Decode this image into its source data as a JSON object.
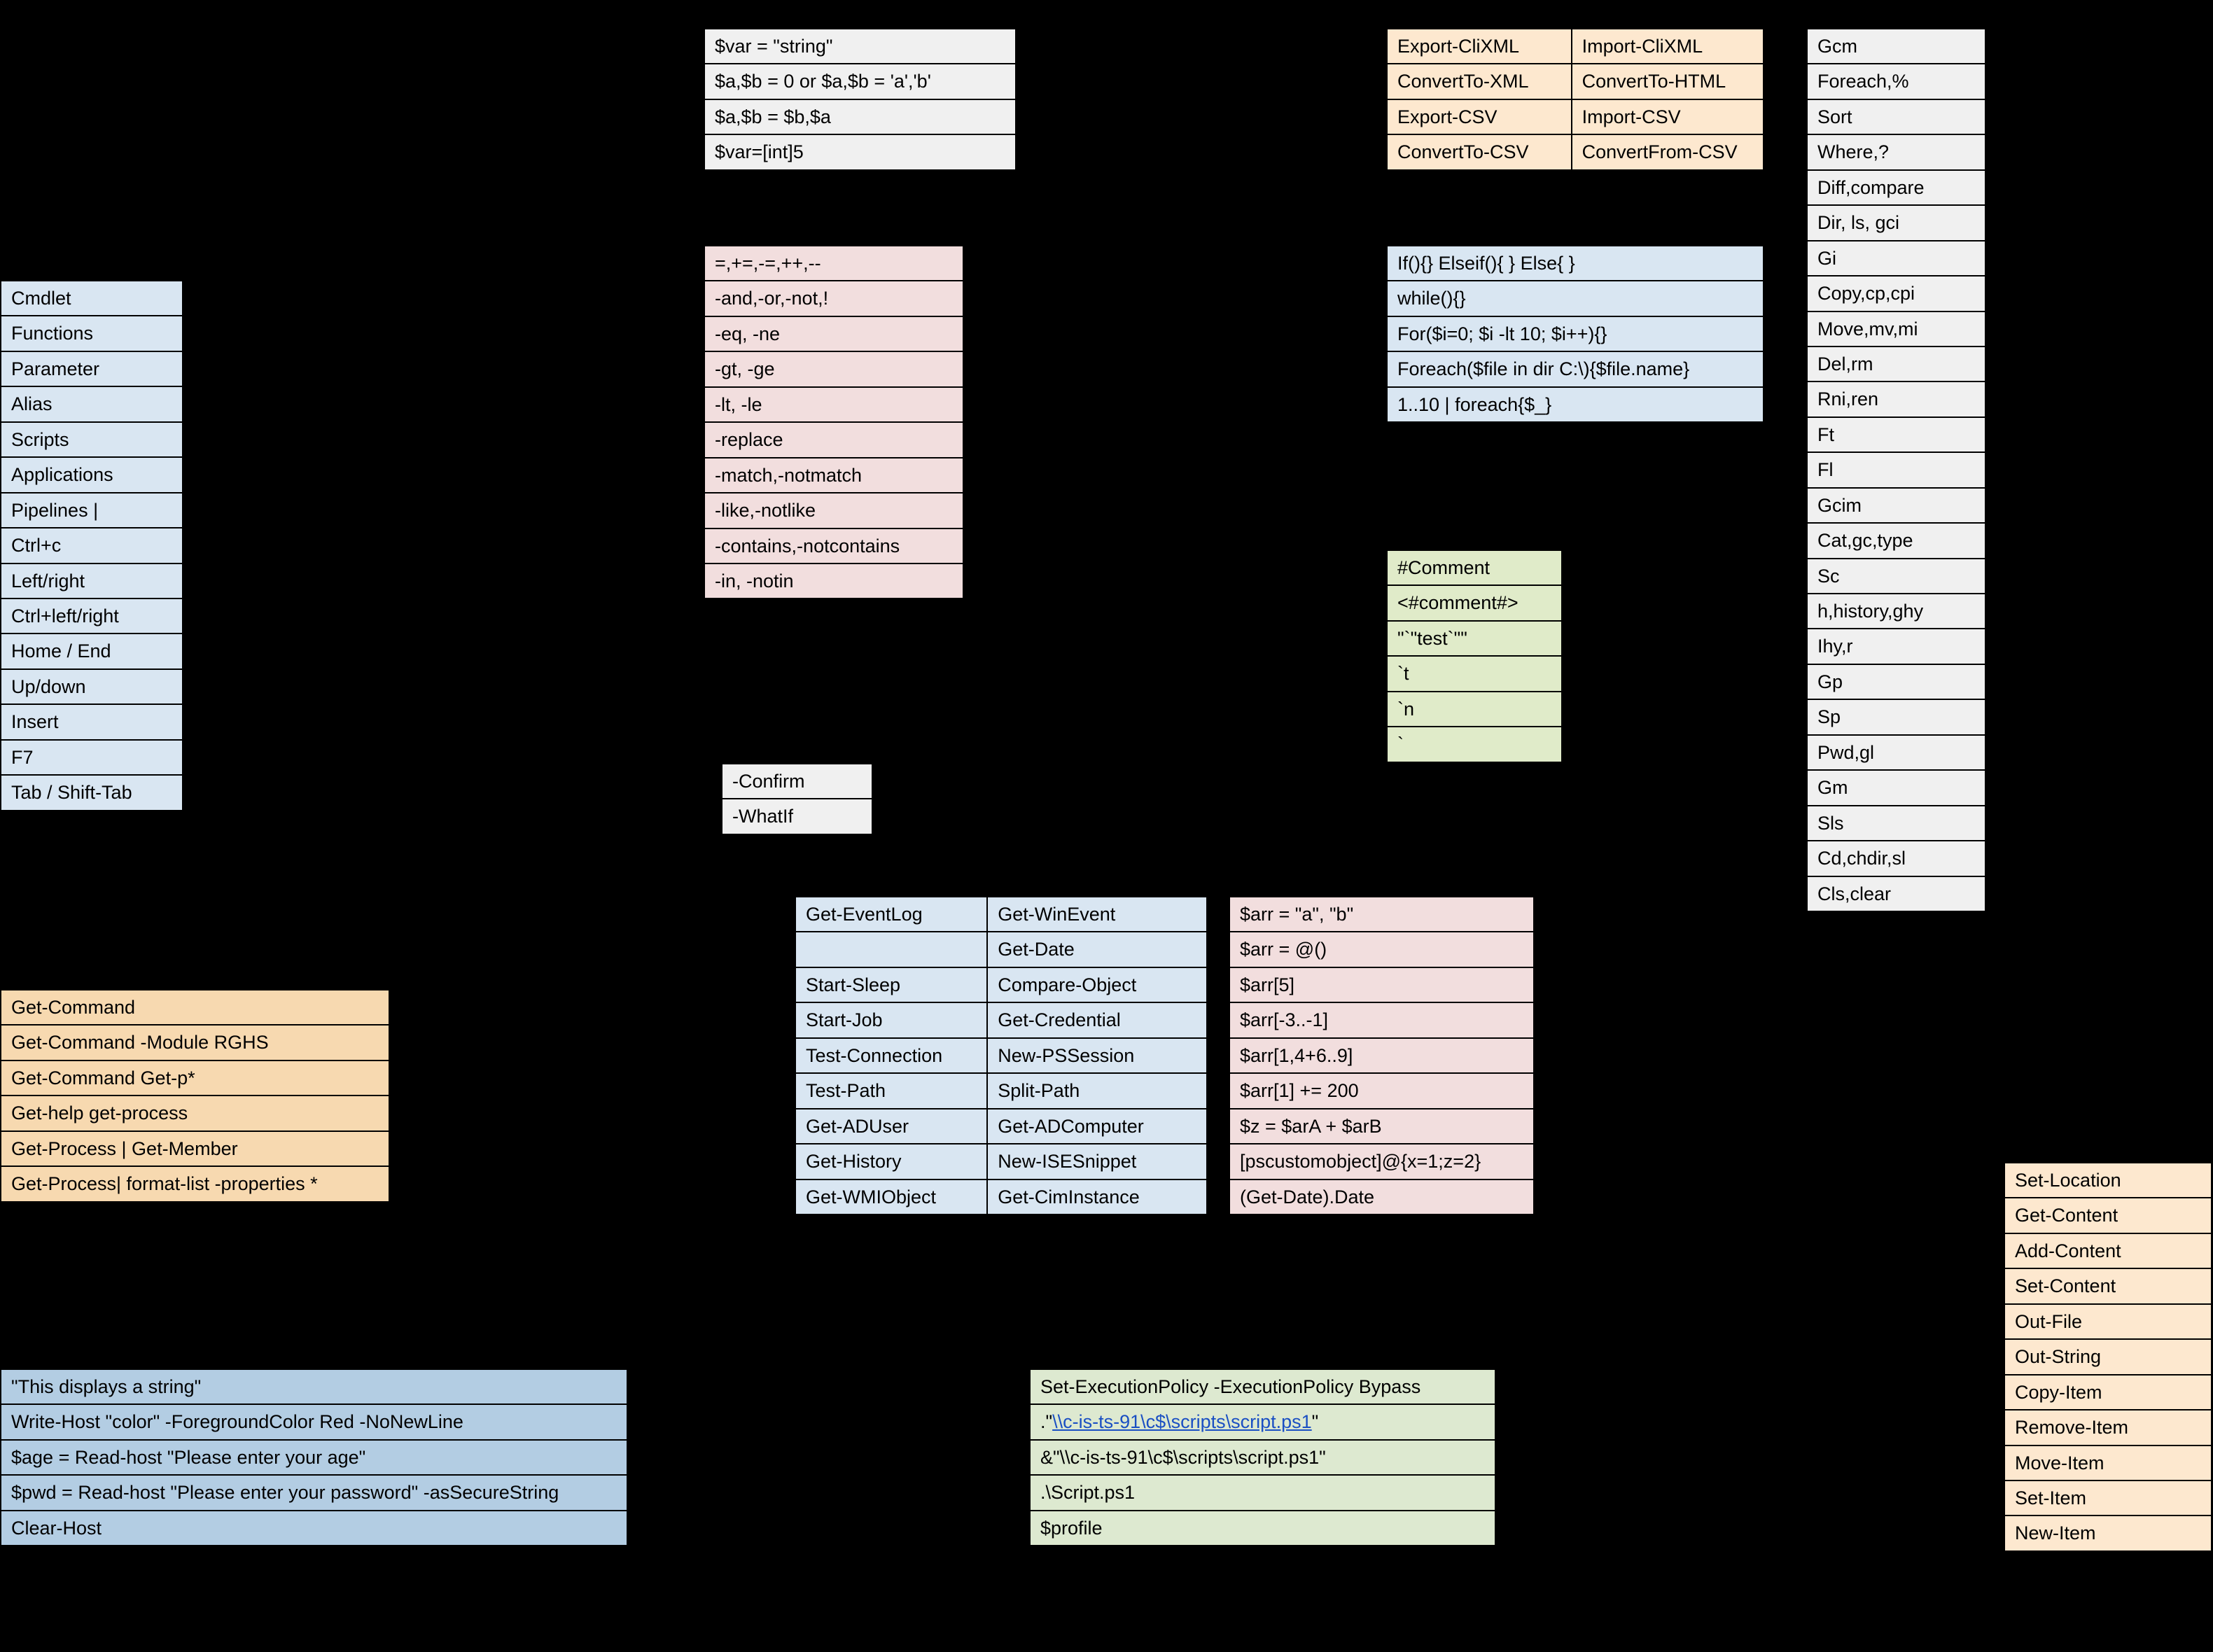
{
  "concepts": {
    "rows": [
      [
        "Cmdlet",
        ""
      ],
      [
        "Functions",
        ""
      ],
      [
        "Parameter",
        ""
      ],
      [
        "Alias",
        ""
      ],
      [
        "Scripts",
        ""
      ],
      [
        "Applications",
        ""
      ],
      [
        "Pipelines |",
        ""
      ],
      [
        "Ctrl+c",
        ""
      ],
      [
        "Left/right",
        ""
      ],
      [
        "Ctrl+left/right",
        ""
      ],
      [
        "Home / End",
        ""
      ],
      [
        "Up/down",
        ""
      ],
      [
        "Insert",
        ""
      ],
      [
        "F7",
        ""
      ],
      [
        "Tab / Shift-Tab",
        ""
      ]
    ]
  },
  "help": {
    "rows": [
      [
        "Get-Command",
        ""
      ],
      [
        "Get-Command -Module RGHS",
        ""
      ],
      [
        "Get-Command Get-p*",
        ""
      ],
      [
        "Get-help get-process",
        ""
      ],
      [
        "Get-Process | Get-Member",
        ""
      ],
      [
        "Get-Process| format-list -properties *",
        ""
      ]
    ]
  },
  "variables": {
    "rows": [
      [
        "$var = \"string\"",
        ""
      ],
      [
        "$a,$b = 0 or $a,$b = 'a','b'",
        ""
      ],
      [
        "$a,$b = $b,$a",
        ""
      ],
      [
        "$var=[int]5",
        ""
      ]
    ]
  },
  "operators": {
    "rows": [
      [
        "=,+=,-=,++,--",
        ""
      ],
      [
        "-and,-or,-not,!",
        ""
      ],
      [
        "-eq, -ne",
        ""
      ],
      [
        "-gt, -ge",
        ""
      ],
      [
        "-lt, -le",
        ""
      ],
      [
        "-replace",
        ""
      ],
      [
        "-match,-notmatch",
        ""
      ],
      [
        "-like,-notlike",
        ""
      ],
      [
        "-contains,-notcontains",
        ""
      ],
      [
        "-in, -notin",
        ""
      ]
    ]
  },
  "risk": {
    "rows": [
      [
        "-Confirm",
        ""
      ],
      [
        "-WhatIf",
        ""
      ]
    ]
  },
  "importexport": {
    "rows": [
      [
        "Export-CliXML",
        "Import-CliXML"
      ],
      [
        "ConvertTo-XML",
        "ConvertTo-HTML"
      ],
      [
        "Export-CSV",
        "Import-CSV"
      ],
      [
        "ConvertTo-CSV",
        "ConvertFrom-CSV"
      ]
    ]
  },
  "flow": {
    "rows": [
      [
        "If(){} Elseif(){ } Else{ }"
      ],
      [
        "while(){}"
      ],
      [
        "For($i=0; $i -lt 10; $i++){}"
      ],
      [
        "Foreach($file in dir C:\\){$file.name}"
      ],
      [
        "1..10 | foreach{$_}"
      ]
    ]
  },
  "comments": {
    "rows": [
      [
        "#Comment",
        ""
      ],
      [
        "<#comment#>",
        ""
      ],
      [
        "\"`\"test`\"\"",
        ""
      ],
      [
        "`t",
        ""
      ],
      [
        "`n",
        ""
      ],
      [
        "`",
        ""
      ]
    ]
  },
  "cmdlets2col": {
    "rows": [
      [
        "Get-EventLog",
        "Get-WinEvent"
      ],
      [
        "",
        "Get-Date"
      ],
      [
        "Start-Sleep",
        "Compare-Object"
      ],
      [
        "Start-Job",
        "Get-Credential"
      ],
      [
        "Test-Connection",
        "New-PSSession"
      ],
      [
        "Test-Path",
        "Split-Path"
      ],
      [
        "Get-ADUser",
        "Get-ADComputer"
      ],
      [
        "Get-History",
        "New-ISESnippet"
      ],
      [
        "Get-WMIObject",
        "Get-CimInstance"
      ]
    ]
  },
  "arrays": {
    "rows": [
      [
        "$arr = \"a\", \"b\"",
        ""
      ],
      [
        "$arr = @()",
        ""
      ],
      [
        "$arr[5]",
        ""
      ],
      [
        "$arr[-3..-1]",
        ""
      ],
      [
        "$arr[1,4+6..9]",
        ""
      ],
      [
        "$arr[1] += 200",
        ""
      ],
      [
        "$z = $arA + $arB",
        ""
      ],
      [
        "[pscustomobject]@{x=1;z=2}",
        ""
      ],
      [
        "(Get-Date).Date",
        ""
      ]
    ]
  },
  "writing": {
    "rows": [
      [
        "\"This displays a string\"",
        ""
      ],
      [
        "Write-Host \"color\" -ForegroundColor Red -NoNewLine",
        ""
      ],
      [
        "$age = Read-host \"Please enter your age\"",
        ""
      ],
      [
        "$pwd = Read-host \"Please enter your password\" -asSecureString",
        ""
      ],
      [
        "Clear-Host",
        ""
      ]
    ]
  },
  "scripts": {
    "rows": [
      [
        "Set-ExecutionPolicy -ExecutionPolicy Bypass",
        ""
      ],
      [
        ".\"\\\\c-is-ts-91\\c$\\scripts\\script.ps1\"",
        ""
      ],
      [
        "&\"\\\\c-is-ts-91\\c$\\scripts\\script.ps1\"",
        ""
      ],
      [
        ".\\Script.ps1",
        ""
      ],
      [
        "$profile",
        ""
      ]
    ],
    "linkRow": 1,
    "linkText": "\\\\c-is-ts-91\\c$\\scripts\\script.ps1"
  },
  "aliases": {
    "rows": [
      [
        "Gcm",
        ""
      ],
      [
        "Foreach,%",
        ""
      ],
      [
        "Sort",
        ""
      ],
      [
        "Where,?",
        ""
      ],
      [
        "Diff,compare",
        ""
      ],
      [
        "Dir, ls, gci",
        ""
      ],
      [
        "Gi",
        ""
      ],
      [
        "Copy,cp,cpi",
        ""
      ],
      [
        "Move,mv,mi",
        ""
      ],
      [
        "Del,rm",
        ""
      ],
      [
        "Rni,ren",
        ""
      ],
      [
        "Ft",
        ""
      ],
      [
        "Fl",
        ""
      ],
      [
        "Gcim",
        ""
      ],
      [
        "Cat,gc,type",
        ""
      ],
      [
        "Sc",
        ""
      ],
      [
        "h,history,ghy",
        ""
      ],
      [
        "Ihy,r",
        ""
      ],
      [
        "Gp",
        ""
      ],
      [
        "Sp",
        ""
      ],
      [
        "Pwd,gl",
        ""
      ],
      [
        "Gm",
        ""
      ],
      [
        "Sls",
        ""
      ],
      [
        "Cd,chdir,sl",
        ""
      ],
      [
        "Cls,clear",
        ""
      ]
    ]
  },
  "commoncmdlets": {
    "rows": [
      [
        "Set-Location"
      ],
      [
        "Get-Content"
      ],
      [
        "Add-Content"
      ],
      [
        "Set-Content"
      ],
      [
        "Out-File"
      ],
      [
        "Out-String"
      ],
      [
        "Copy-Item"
      ],
      [
        "Remove-Item"
      ],
      [
        "Move-Item"
      ],
      [
        "Set-Item"
      ],
      [
        "New-Item"
      ]
    ]
  }
}
